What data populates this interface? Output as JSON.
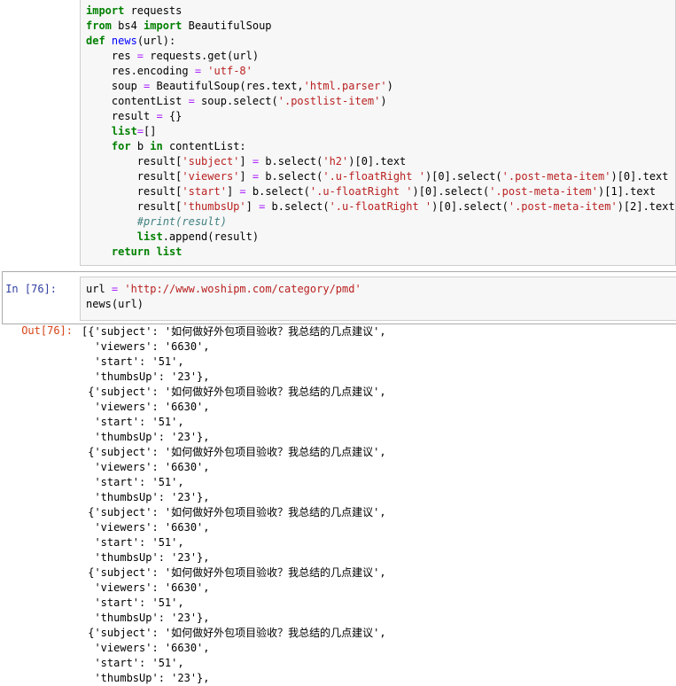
{
  "cell1": {
    "lines": [
      [
        {
          "t": "import",
          "c": "kw"
        },
        {
          "t": " requests"
        }
      ],
      [
        {
          "t": "from",
          "c": "kw"
        },
        {
          "t": " bs4 "
        },
        {
          "t": "import",
          "c": "kw"
        },
        {
          "t": " BeautifulSoup"
        }
      ],
      [
        {
          "t": "def",
          "c": "kw"
        },
        {
          "t": " "
        },
        {
          "t": "news",
          "c": "fn"
        },
        {
          "t": "(url):"
        }
      ],
      [
        {
          "t": "    res "
        },
        {
          "t": "=",
          "c": "op"
        },
        {
          "t": " requests.get(url)"
        }
      ],
      [
        {
          "t": "    res.encoding "
        },
        {
          "t": "=",
          "c": "op"
        },
        {
          "t": " "
        },
        {
          "t": "'utf-8'",
          "c": "str"
        }
      ],
      [
        {
          "t": "    soup "
        },
        {
          "t": "=",
          "c": "op"
        },
        {
          "t": " BeautifulSoup(res.text,"
        },
        {
          "t": "'html.parser'",
          "c": "str"
        },
        {
          "t": ")"
        }
      ],
      [
        {
          "t": "    contentList "
        },
        {
          "t": "=",
          "c": "op"
        },
        {
          "t": " soup.select("
        },
        {
          "t": "'.postlist-item'",
          "c": "str"
        },
        {
          "t": ")"
        }
      ],
      [
        {
          "t": "    result "
        },
        {
          "t": "=",
          "c": "op"
        },
        {
          "t": " {}"
        }
      ],
      [
        {
          "t": "    "
        },
        {
          "t": "list",
          "c": "kw"
        },
        {
          "t": "=",
          "c": "op"
        },
        {
          "t": "[]"
        }
      ],
      [
        {
          "t": "    "
        },
        {
          "t": "for",
          "c": "kw"
        },
        {
          "t": " b "
        },
        {
          "t": "in",
          "c": "kw"
        },
        {
          "t": " contentList:"
        }
      ],
      [
        {
          "t": "        result["
        },
        {
          "t": "'subject'",
          "c": "str"
        },
        {
          "t": "] "
        },
        {
          "t": "=",
          "c": "op"
        },
        {
          "t": " b.select("
        },
        {
          "t": "'h2'",
          "c": "str"
        },
        {
          "t": ")[0].text"
        }
      ],
      [
        {
          "t": "        result["
        },
        {
          "t": "'viewers'",
          "c": "str"
        },
        {
          "t": "] "
        },
        {
          "t": "=",
          "c": "op"
        },
        {
          "t": " b.select("
        },
        {
          "t": "'.u-floatRight '",
          "c": "str"
        },
        {
          "t": ")[0].select("
        },
        {
          "t": "'.post-meta-item'",
          "c": "str"
        },
        {
          "t": ")[0].text"
        }
      ],
      [
        {
          "t": "        result["
        },
        {
          "t": "'start'",
          "c": "str"
        },
        {
          "t": "] "
        },
        {
          "t": "=",
          "c": "op"
        },
        {
          "t": " b.select("
        },
        {
          "t": "'.u-floatRight '",
          "c": "str"
        },
        {
          "t": ")[0].select("
        },
        {
          "t": "'.post-meta-item'",
          "c": "str"
        },
        {
          "t": ")[1].text"
        }
      ],
      [
        {
          "t": "        result["
        },
        {
          "t": "'thumbsUp'",
          "c": "str"
        },
        {
          "t": "] "
        },
        {
          "t": "=",
          "c": "op"
        },
        {
          "t": " b.select("
        },
        {
          "t": "'.u-floatRight '",
          "c": "str"
        },
        {
          "t": ")[0].select("
        },
        {
          "t": "'.post-meta-item'",
          "c": "str"
        },
        {
          "t": ")[2].text"
        }
      ],
      [
        {
          "t": "        "
        },
        {
          "t": "#print(result)",
          "c": "cm"
        }
      ],
      [
        {
          "t": "        "
        },
        {
          "t": "list",
          "c": "kw"
        },
        {
          "t": ".append(result)"
        }
      ],
      [
        {
          "t": "    "
        },
        {
          "t": "return",
          "c": "kw"
        },
        {
          "t": " "
        },
        {
          "t": "list",
          "c": "kw"
        }
      ]
    ]
  },
  "cell2": {
    "in_prompt": "In  [76]:",
    "out_prompt": "Out[76]:",
    "lines": [
      [
        {
          "t": "url "
        },
        {
          "t": "=",
          "c": "op"
        },
        {
          "t": " "
        },
        {
          "t": "'http://www.woshipm.com/category/pmd'",
          "c": "str"
        }
      ],
      [
        {
          "t": "news(url)"
        }
      ]
    ]
  },
  "output": {
    "lines": [
      "[{'subject': '如何做好外包项目验收？我总结的几点建议',",
      "  'viewers': '6630',",
      "  'start': '51',",
      "  'thumbsUp': '23'},",
      " {'subject': '如何做好外包项目验收？我总结的几点建议',",
      "  'viewers': '6630',",
      "  'start': '51',",
      "  'thumbsUp': '23'},",
      " {'subject': '如何做好外包项目验收？我总结的几点建议',",
      "  'viewers': '6630',",
      "  'start': '51',",
      "  'thumbsUp': '23'},",
      " {'subject': '如何做好外包项目验收？我总结的几点建议',",
      "  'viewers': '6630',",
      "  'start': '51',",
      "  'thumbsUp': '23'},",
      " {'subject': '如何做好外包项目验收？我总结的几点建议',",
      "  'viewers': '6630',",
      "  'start': '51',",
      "  'thumbsUp': '23'},",
      " {'subject': '如何做好外包项目验收？我总结的几点建议',",
      "  'viewers': '6630',",
      "  'start': '51',",
      "  'thumbsUp': '23'},"
    ]
  },
  "colors": {
    "keyword": "#008000",
    "string": "#ba2121",
    "operator": "#aa22ff",
    "function": "#0000ff",
    "comment": "#408080",
    "in_prompt": "#303f9f",
    "out_prompt": "#d84315",
    "cell_bg": "#f7f7f7"
  }
}
